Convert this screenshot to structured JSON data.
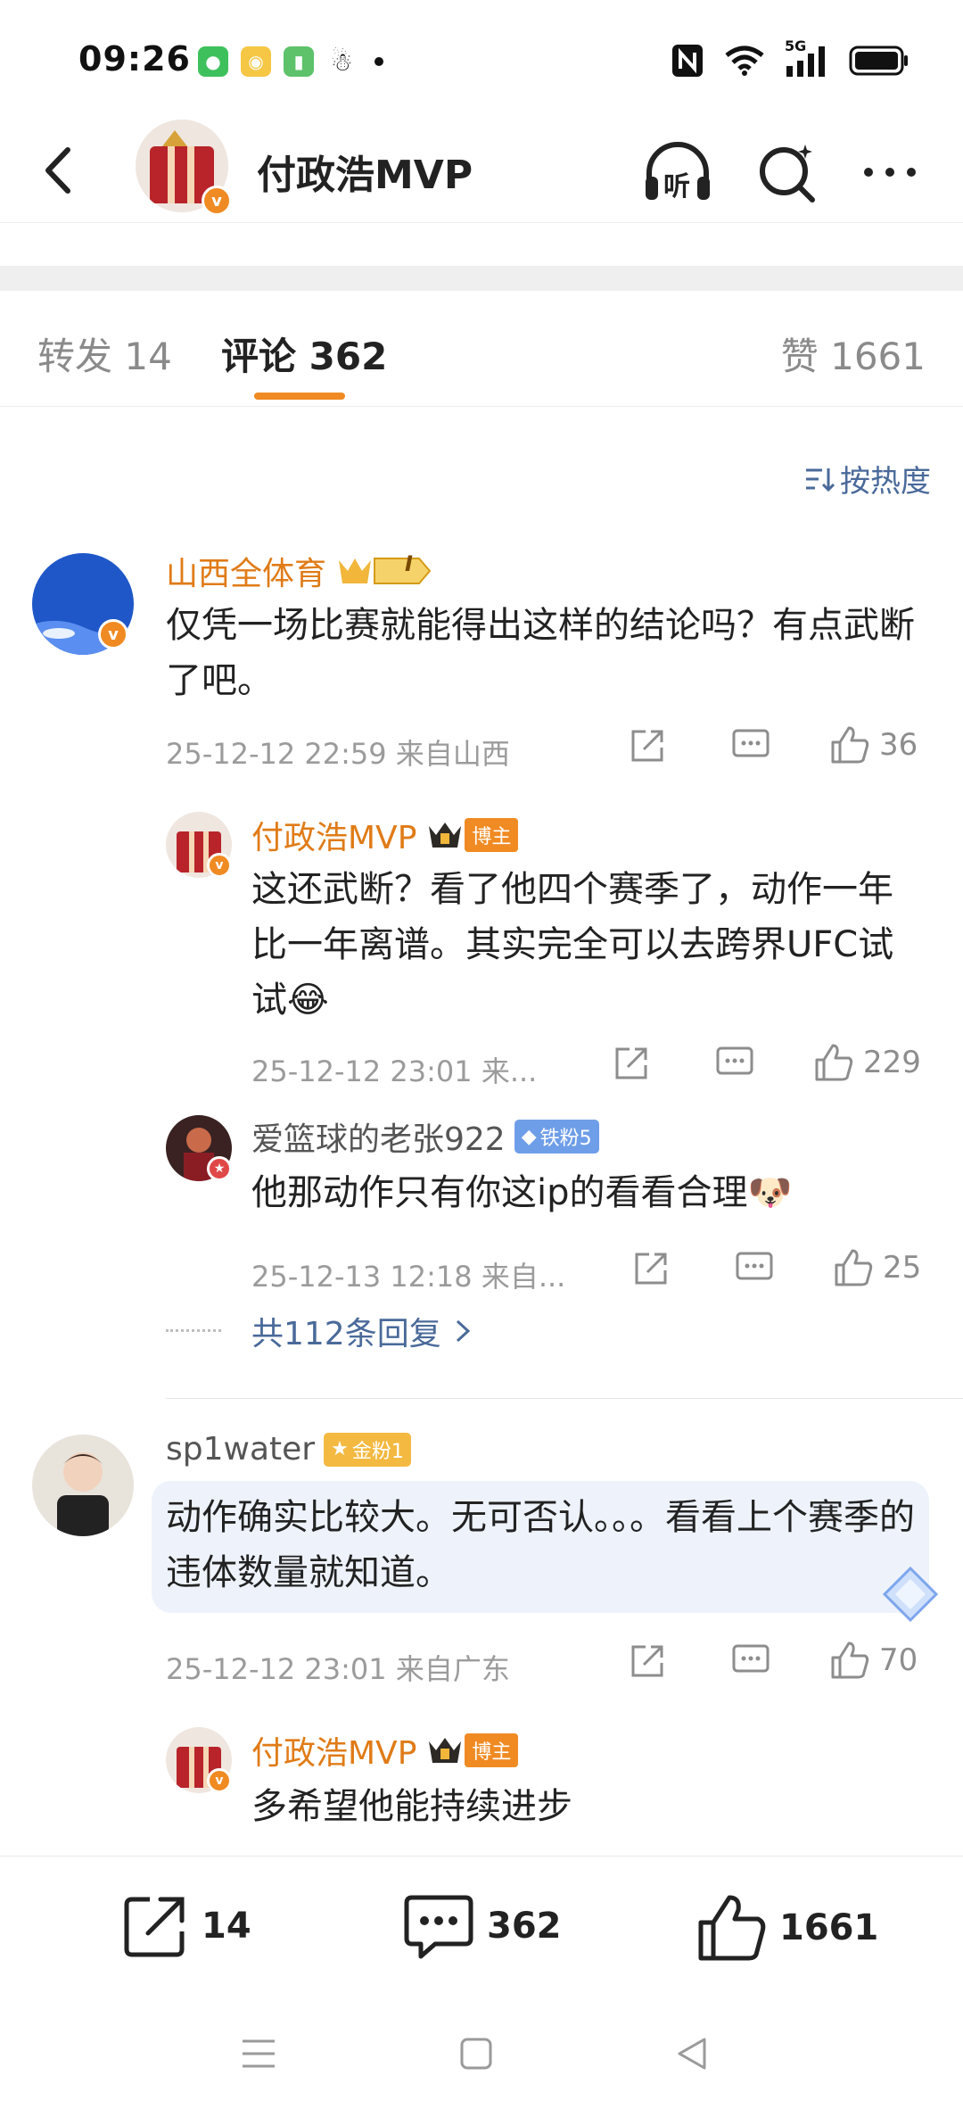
{
  "status_bar": {
    "time": "09:26",
    "notification_icons": [
      "wechat-icon",
      "weibo-icon",
      "battery-app-icon",
      "qq-icon"
    ],
    "system_icons": [
      "nfc-icon",
      "wifi-icon",
      "5g-signal-icon",
      "battery-icon"
    ],
    "network_label": "5G"
  },
  "header": {
    "title": "付政浩MVP",
    "listen_label": "听"
  },
  "tabs": [
    {
      "label": "转发 14"
    },
    {
      "label": "评论 362",
      "active": true
    },
    {
      "label": "赞 1661"
    }
  ],
  "sort_label": "按热度",
  "comments": [
    {
      "user": "山西全体育",
      "level_badge": "I",
      "text": "仅凭一场比赛就能得出这样的结论吗？有点武断了吧。",
      "meta": "25-12-12 22:59  来自山西",
      "likes": "36",
      "replies": [
        {
          "user": "付政浩MVP",
          "role_badge": "博主",
          "text": "这还武断？看了他四个赛季了，动作一年比一年离谱。其实完全可以去跨界UFC试试😂",
          "meta": "25-12-12 23:01  来...",
          "likes": "229"
        },
        {
          "user": "爱篮球的老张922",
          "fan_badge": "铁粉5",
          "text": "他那动作只有你这ip的看看合理🐶",
          "meta": "25-12-13 12:18  来自...",
          "likes": "25"
        }
      ],
      "more_replies": "共112条回复"
    },
    {
      "user": "sp1water",
      "fan_badge": "金粉1",
      "text": "动作确实比较大。无可否认。。。看看上个赛季的违体数量就知道。",
      "meta": "25-12-12 23:01  来自广东",
      "likes": "70",
      "replies": [
        {
          "user": "付政浩MVP",
          "role_badge": "博主",
          "text": "多希望他能持续进步"
        }
      ]
    }
  ],
  "bottom_bar": {
    "repost_count": "14",
    "comment_count": "362",
    "like_count": "1661"
  },
  "colors": {
    "accent": "#f08a22",
    "link": "#4a6a9a",
    "muted": "#9b9b9b"
  }
}
